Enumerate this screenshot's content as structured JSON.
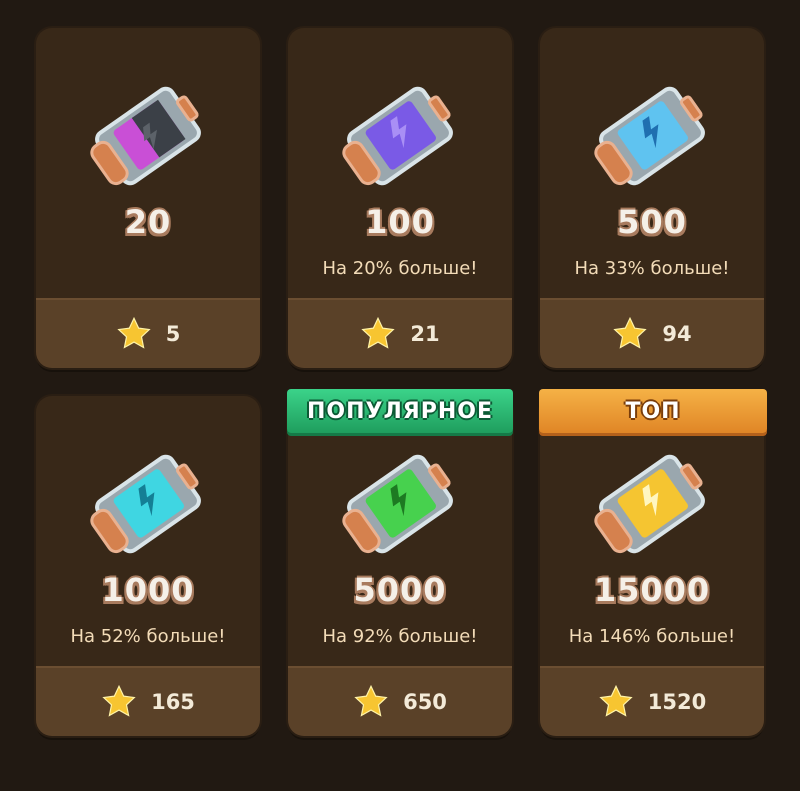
{
  "colors": {
    "background": "#211912",
    "card": "#382818",
    "price_bar": "#5a4128",
    "star": "#f7c531"
  },
  "items": [
    {
      "amount": "20",
      "bonus": "",
      "price": "5",
      "icon": "pink-energy-battery-icon",
      "accent": "#c94fd6"
    },
    {
      "amount": "100",
      "bonus": "На 20% больше!",
      "price": "21",
      "icon": "purple-energy-battery-icon",
      "accent": "#7a5ae6"
    },
    {
      "amount": "500",
      "bonus": "На 33% больше!",
      "price": "94",
      "icon": "blue-energy-battery-icon",
      "accent": "#5fc3f0"
    },
    {
      "amount": "1000",
      "bonus": "На 52% больше!",
      "price": "165",
      "icon": "cyan-energy-battery-icon",
      "accent": "#3fd6e2"
    },
    {
      "amount": "5000",
      "bonus": "На 92% больше!",
      "price": "650",
      "icon": "green-energy-battery-icon",
      "accent": "#47d14e"
    },
    {
      "amount": "15000",
      "bonus": "На 146% больше!",
      "price": "1520",
      "icon": "gold-energy-battery-icon",
      "accent": "#f5c531"
    }
  ],
  "badges": {
    "popular": "ПОПУЛЯРНОЕ",
    "top": "ТОП"
  }
}
